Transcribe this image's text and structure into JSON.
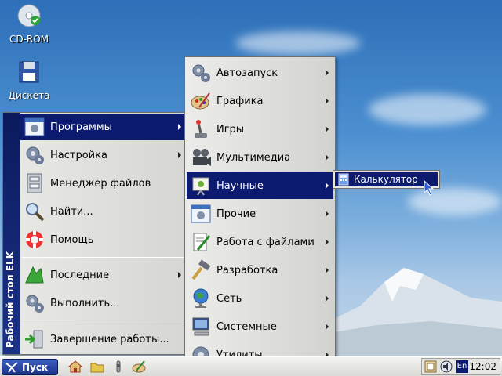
{
  "desktop": {
    "icons": [
      {
        "label": "CD-ROM",
        "icon": "cd-rom-icon"
      },
      {
        "label": "Дискета",
        "icon": "floppy-icon"
      }
    ]
  },
  "start_menu": {
    "sidebar_title": "Рабочий стол ELK",
    "items": [
      {
        "label": "Программы",
        "icon": "programs-icon",
        "selected": true,
        "submenu": true
      },
      {
        "label": "Настройка",
        "icon": "settings-icon",
        "submenu": true
      },
      {
        "label": "Менеджер файлов",
        "icon": "file-manager-icon"
      },
      {
        "label": "Найти...",
        "icon": "search-icon"
      },
      {
        "label": "Помощь",
        "icon": "help-icon"
      },
      {
        "label": "Последние",
        "icon": "recent-icon",
        "submenu": true
      },
      {
        "label": "Выполнить...",
        "icon": "run-icon"
      },
      {
        "label": "Завершение работы...",
        "icon": "shutdown-icon"
      }
    ]
  },
  "programs_menu": {
    "items": [
      {
        "label": "Автозапуск",
        "icon": "autostart-icon"
      },
      {
        "label": "Графика",
        "icon": "graphics-icon"
      },
      {
        "label": "Игры",
        "icon": "games-icon"
      },
      {
        "label": "Мультимедиа",
        "icon": "multimedia-icon"
      },
      {
        "label": "Научные",
        "icon": "science-icon",
        "selected": true
      },
      {
        "label": "Прочие",
        "icon": "other-icon"
      },
      {
        "label": "Работа с файлами",
        "icon": "files-icon"
      },
      {
        "label": "Разработка",
        "icon": "development-icon"
      },
      {
        "label": "Сеть",
        "icon": "network-icon"
      },
      {
        "label": "Системные",
        "icon": "system-icon"
      },
      {
        "label": "Утилиты",
        "icon": "utilities-icon"
      }
    ]
  },
  "science_menu": {
    "items": [
      {
        "label": "Калькулятор",
        "icon": "calculator-icon"
      }
    ]
  },
  "taskbar": {
    "start_label": "Пуск",
    "quicklaunch": [
      "home-icon",
      "folder-icon",
      "mixer-icon",
      "paint-icon"
    ],
    "lang": "En",
    "clock": "12:02"
  },
  "colors": {
    "selection": "#0c1b6f",
    "sidebar": "#0b1a5c"
  }
}
